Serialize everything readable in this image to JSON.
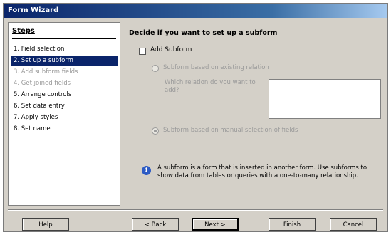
{
  "window": {
    "title": "Form Wizard"
  },
  "steps": {
    "title": "Steps",
    "items": [
      {
        "label": "1. Field selection",
        "state": "normal"
      },
      {
        "label": "2. Set up a subform",
        "state": "active"
      },
      {
        "label": "3. Add subform fields",
        "state": "disabled"
      },
      {
        "label": "4. Get joined fields",
        "state": "disabled"
      },
      {
        "label": "5. Arrange controls",
        "state": "normal"
      },
      {
        "label": "6. Set data entry",
        "state": "normal"
      },
      {
        "label": "7. Apply styles",
        "state": "normal"
      },
      {
        "label": "8. Set name",
        "state": "normal"
      }
    ]
  },
  "content": {
    "heading": "Decide if you want to set up a subform",
    "add_subform_label": "Add Subform",
    "add_subform_checked": false,
    "option_relation_label": "Subform based on existing relation",
    "relation_question": "Which relation do you want to add?",
    "option_manual_label": "Subform based on manual selection of fields",
    "info_text": "A subform is a form that is inserted in another form. Use subforms to show data from tables or queries with a one-to-many relationship."
  },
  "buttons": {
    "help": "Help",
    "back": "< Back",
    "next": "Next >",
    "finish": "Finish",
    "cancel": "Cancel"
  }
}
